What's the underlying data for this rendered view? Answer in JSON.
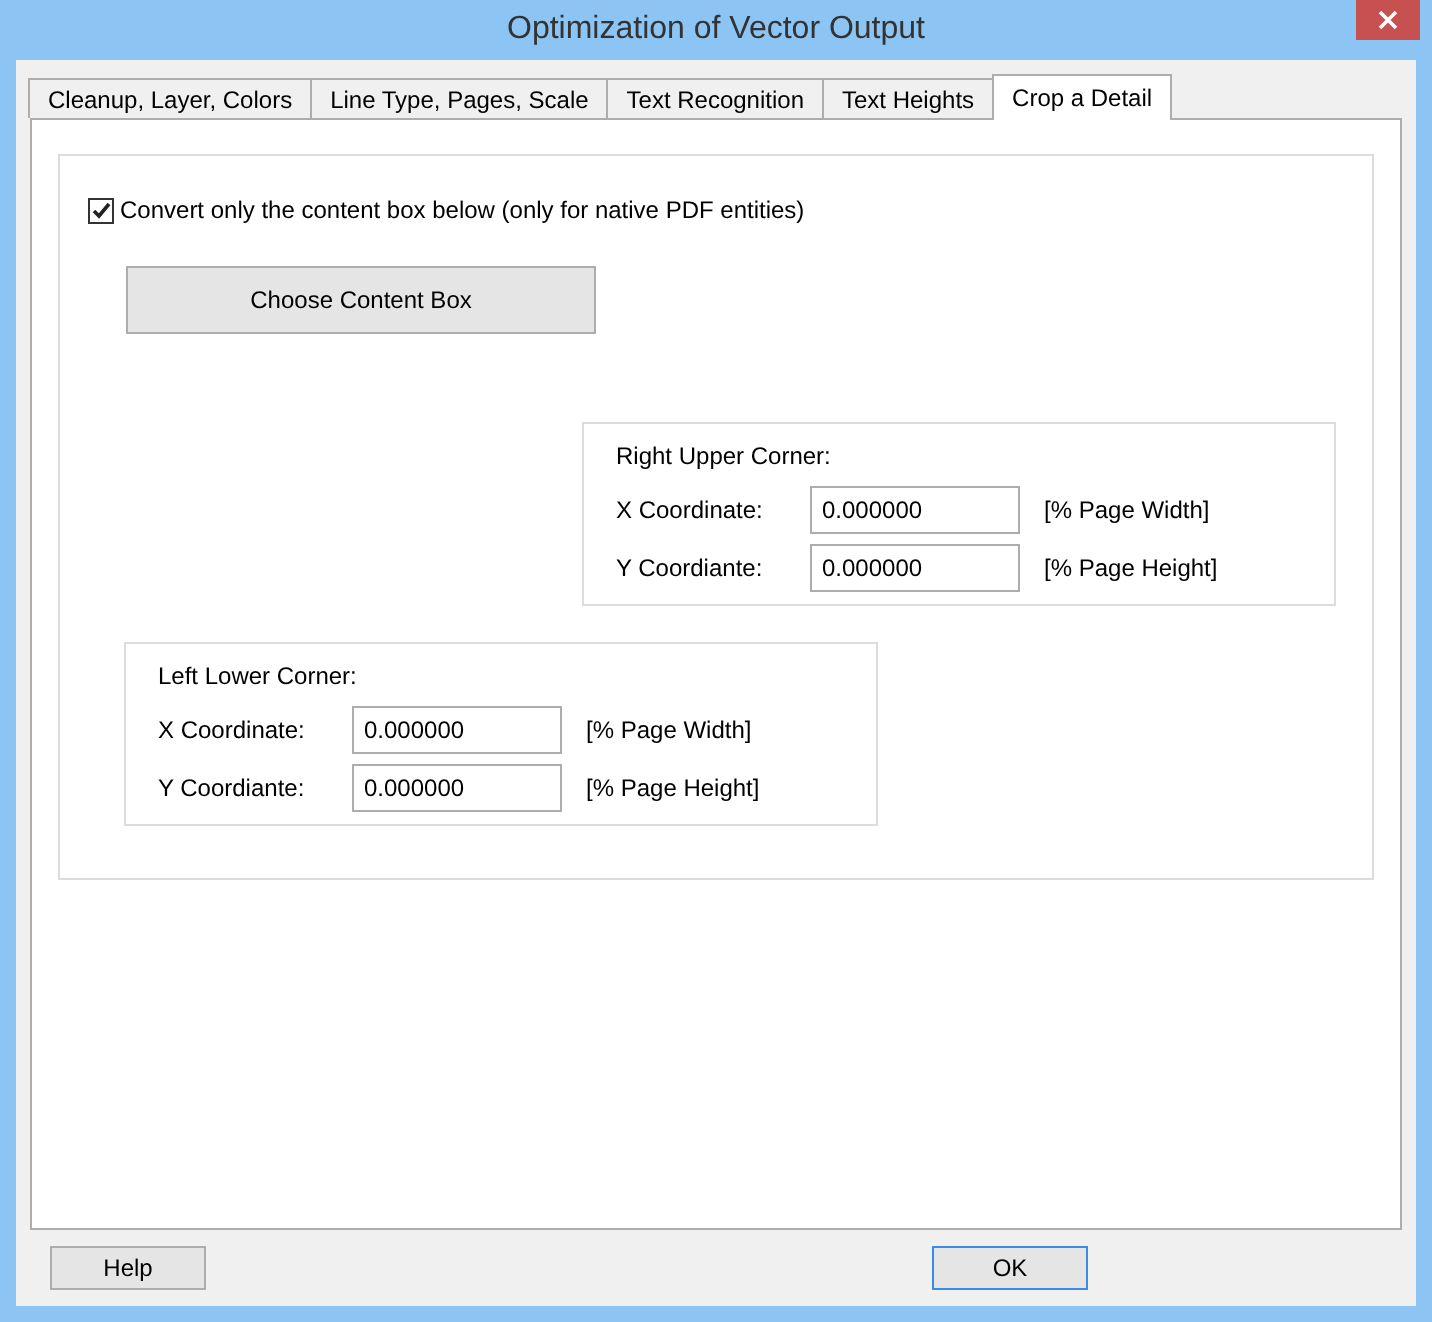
{
  "window": {
    "title": "Optimization of Vector Output"
  },
  "tabs": [
    {
      "label": "Cleanup, Layer, Colors",
      "selected": false
    },
    {
      "label": "Line Type, Pages, Scale",
      "selected": false
    },
    {
      "label": "Text Recognition",
      "selected": false
    },
    {
      "label": "Text Heights",
      "selected": false
    },
    {
      "label": "Crop a Detail",
      "selected": true
    }
  ],
  "crop_option": {
    "label": "Convert only the content box below (only for native PDF entities)",
    "checked": true
  },
  "choose_button": "Choose Content Box",
  "groups": [
    {
      "title": "Right Upper Corner:",
      "rows": [
        {
          "label": "X Coordinate:",
          "value": "0.000000",
          "unit": "[% Page Width]"
        },
        {
          "label": "Y Coordiante:",
          "value": "0.000000",
          "unit": "[% Page Height]"
        }
      ]
    },
    {
      "title": "Left Lower Corner:",
      "rows": [
        {
          "label": "X Coordinate:",
          "value": "0.000000",
          "unit": "[% Page Width]"
        },
        {
          "label": "Y Coordiante:",
          "value": "0.000000",
          "unit": "[% Page Height]"
        }
      ]
    }
  ],
  "footer_buttons": [
    {
      "label": "Help",
      "default": false
    },
    {
      "label": "OK",
      "default": true
    }
  ]
}
